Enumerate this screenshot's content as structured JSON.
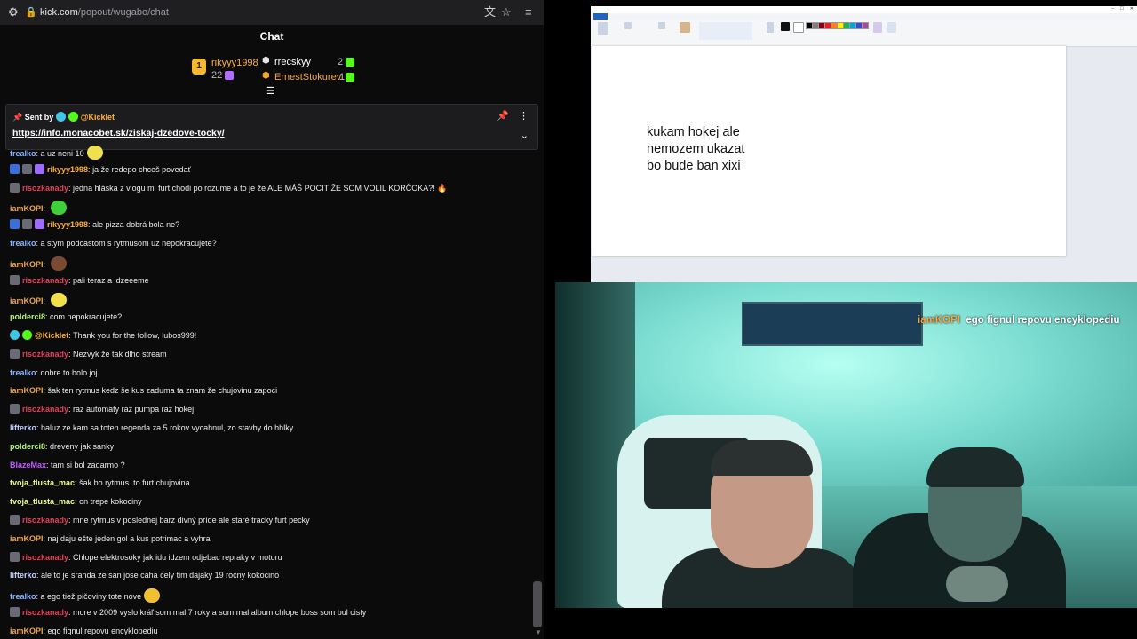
{
  "browser": {
    "url_host": "kick.com",
    "url_path": "/popout/wugabo/chat"
  },
  "chat": {
    "title": "Chat",
    "leaderboard": {
      "top": {
        "name": "rikyyy1998",
        "rank": "1",
        "count": "22"
      },
      "others": [
        {
          "name": "rrecskyy",
          "count": "2"
        },
        {
          "name": "ErnestStokurev",
          "count": "1"
        }
      ]
    },
    "pinned": {
      "sent_by_label": "Sent by",
      "sender": "@Kicklet",
      "link": "https://info.monacobet.sk/ziskaj-dzedove-tocky/"
    },
    "messages": [
      {
        "user": "frealko",
        "color": "#8fb3ff",
        "text": "a uz neni 10",
        "badges": [],
        "emote": "#f0e050"
      },
      {
        "user": "rikyyy1998",
        "color": "#ffb13b",
        "text": "ja že redepo chceš povedať",
        "badges": [
          "blue",
          "grey",
          "purp"
        ]
      },
      {
        "user": "risozkanady",
        "color": "#e0405a",
        "text": "jedna hláska z vlogu mi furt chodi po rozume a to je že ALE MÁŠ POCIT ŽE SOM VOLIL KORČOKA?! 🔥",
        "badges": [
          "grey"
        ]
      },
      {
        "user": "iamKOPI",
        "color": "#f0a64a",
        "text": "",
        "badges": [],
        "emote": "#3fcf3a"
      },
      {
        "user": "rikyyy1998",
        "color": "#ffb13b",
        "text": "ale pizza dobrá bola ne?",
        "badges": [
          "blue",
          "grey",
          "purp"
        ]
      },
      {
        "user": "frealko",
        "color": "#8fb3ff",
        "text": "a stym podcastom s rytmusom uz nepokracujete?",
        "badges": []
      },
      {
        "user": "iamKOPI",
        "color": "#f0a64a",
        "text": "",
        "badges": [],
        "emote": "#7a4a32"
      },
      {
        "user": "risozkanady",
        "color": "#e0405a",
        "text": "pali teraz a idzeeeme",
        "badges": [
          "grey"
        ]
      },
      {
        "user": "iamKOPI",
        "color": "#f0a64a",
        "text": "",
        "badges": [],
        "emote": "#f2e04a"
      },
      {
        "user": "polderci8",
        "color": "#b9f27a",
        "text": "com nepokracujete?",
        "badges": []
      },
      {
        "user": "@Kicklet",
        "color": "#ffb13b",
        "text": "Thank you for the follow, lubos999!",
        "badges": [
          "cyan",
          "green"
        ]
      },
      {
        "user": "risozkanady",
        "color": "#e0405a",
        "text": "Nezvyk že tak dlho stream",
        "badges": [
          "grey"
        ]
      },
      {
        "user": "frealko",
        "color": "#8fb3ff",
        "text": "dobre to bolo joj",
        "badges": []
      },
      {
        "user": "iamKOPI",
        "color": "#f0a64a",
        "text": "šak ten rytmus kedz še kus zaduma ta znam že chujovinu zapoci",
        "badges": []
      },
      {
        "user": "risozkanady",
        "color": "#e0405a",
        "text": "raz automaty raz pumpa raz hokej",
        "badges": [
          "grey"
        ]
      },
      {
        "user": "lifterko",
        "color": "#c6d0ff",
        "text": "haluz ze kam sa toten regenda za 5 rokov vycahnul, zo stavby do hhlky",
        "badges": []
      },
      {
        "user": "polderci8",
        "color": "#b9f27a",
        "text": "dreveny jak sanky",
        "badges": []
      },
      {
        "user": "BlazeMax",
        "color": "#c05bff",
        "text": "tam si bol zadarmo ?",
        "badges": []
      },
      {
        "user": "tvoja_tlusta_mac",
        "color": "#e8ff8a",
        "text": "šak bo rytmus. to furt chujovina",
        "badges": []
      },
      {
        "user": "tvoja_tlusta_mac",
        "color": "#e8ff8a",
        "text": "on trepe kokociny",
        "badges": []
      },
      {
        "user": "risozkanady",
        "color": "#e0405a",
        "text": "mne rytmus v poslednej barz divný príde ale staré tracky furt pecky",
        "badges": [
          "grey"
        ]
      },
      {
        "user": "iamKOPI",
        "color": "#f0a64a",
        "text": "naj daju ešte jeden gol a kus potrimac a vyhra",
        "badges": []
      },
      {
        "user": "risozkanady",
        "color": "#e0405a",
        "text": "Chlope elektrosoky jak idu idzem odjebac repraky v motoru",
        "badges": [
          "grey"
        ]
      },
      {
        "user": "lifterko",
        "color": "#c6d0ff",
        "text": "ale to je sranda ze san jose caha cely tim dajaky 19 rocny kokocino",
        "badges": []
      },
      {
        "user": "frealko",
        "color": "#8fb3ff",
        "text": "a ego tiež pičoviny tote nove",
        "badges": [],
        "emote": "#f0c030"
      },
      {
        "user": "risozkanady",
        "color": "#e0405a",
        "text": "more v 2009 vyslo kráľ som mal 7 roky a som mal album chlope boss som bul cisty",
        "badges": [
          "grey"
        ]
      },
      {
        "user": "iamKOPI",
        "color": "#f0a64a",
        "text": "ego fignul repovu encyklopediu",
        "badges": []
      }
    ]
  },
  "paint": {
    "text_lines": [
      "kukam hokej ale",
      "nemozem ukazat",
      "bo bude ban xixi"
    ]
  },
  "stream_overlay": {
    "user": "iamKOPI",
    "text": "ego fignul repovu encyklopediu"
  }
}
